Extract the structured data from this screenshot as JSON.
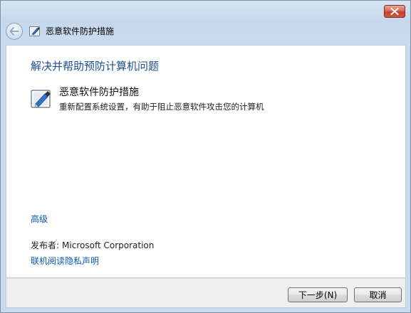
{
  "window": {
    "title": "恶意软件防护措施"
  },
  "header": {
    "back_icon": "back-arrow-icon",
    "close_icon": "close-icon"
  },
  "main": {
    "heading": "解决并帮助预防计算机问题",
    "item": {
      "icon": "troubleshooter-icon",
      "title": "恶意软件防护措施",
      "description": "重新配置系统设置，有助于阻止恶意软件攻击您的计算机"
    },
    "advanced_link": "高级",
    "publisher_label": "发布者:",
    "publisher_name": "Microsoft Corporation",
    "privacy_link": "联机阅读隐私声明"
  },
  "footer": {
    "next_label": "下一步(N)",
    "cancel_label": "取消"
  },
  "colors": {
    "accent_heading": "#1e4d8f",
    "link": "#0c58b6",
    "close_button": "#c2412a"
  }
}
